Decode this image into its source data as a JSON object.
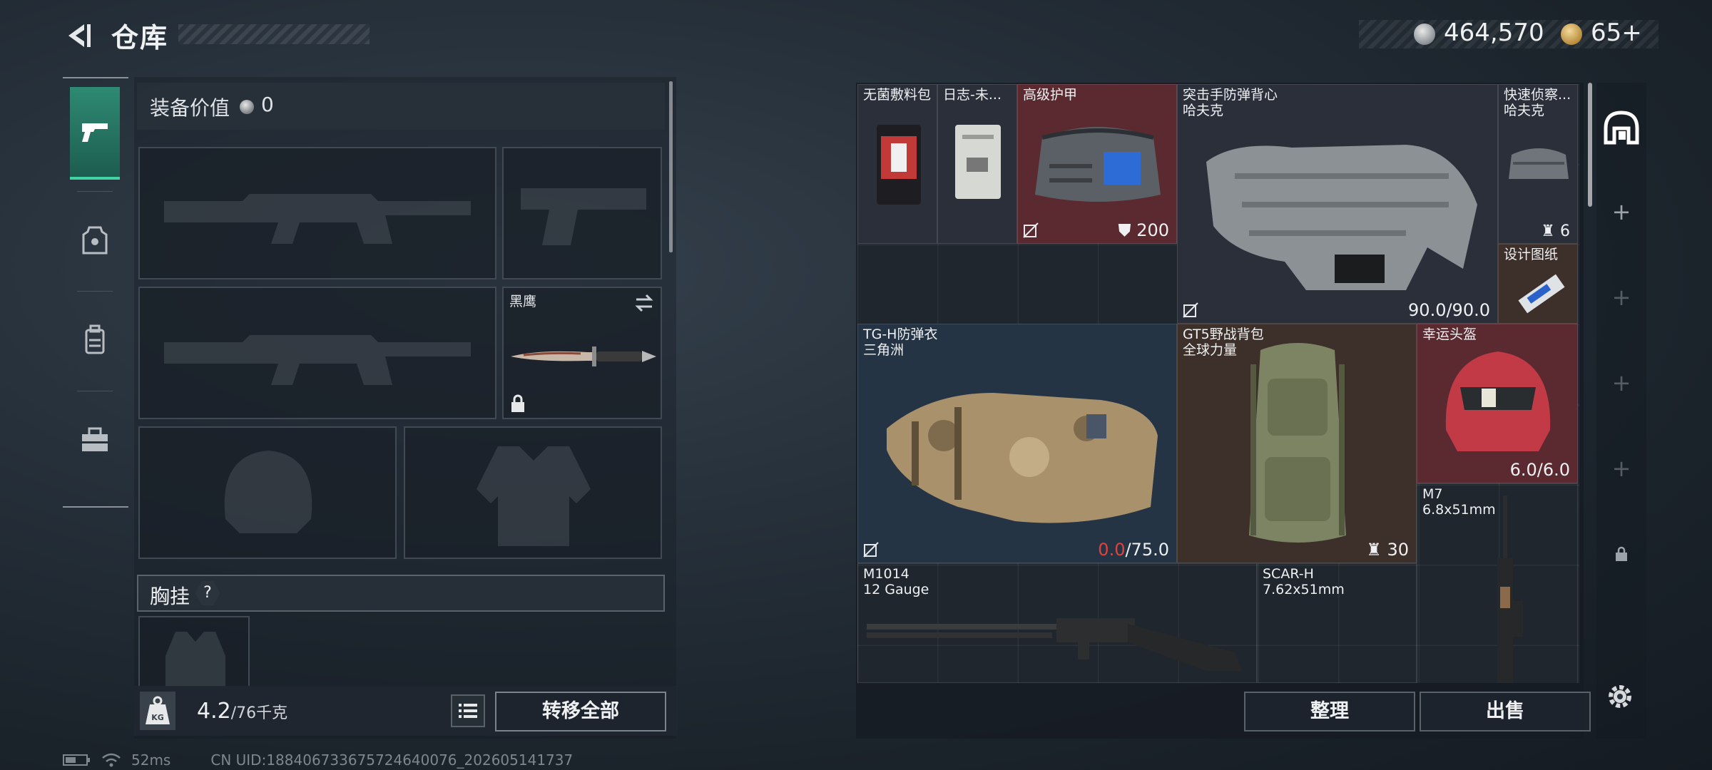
{
  "header": {
    "title": "仓库",
    "money": "464,570",
    "gold": "65+"
  },
  "tabs": [
    {
      "name": "pistol-icon",
      "active": true
    },
    {
      "name": "equipment-icon",
      "active": false
    },
    {
      "name": "backpack-icon",
      "active": false
    },
    {
      "name": "toolbox-icon",
      "active": false
    }
  ],
  "equipment": {
    "value_label": "装备价值",
    "value": "0",
    "knife_label": "黑鹰",
    "chest_rig_label": "胸挂",
    "help": "?"
  },
  "weight": {
    "current": "4.2",
    "max": "/76千克"
  },
  "buttons": {
    "transfer_all": "转移全部",
    "sort": "整理",
    "sell": "出售"
  },
  "status": {
    "ping": "52ms",
    "uid": "CN UID:18840673367572464007​6_202605141737"
  },
  "warehouse": {
    "items": [
      {
        "name": "无菌敷料包"
      },
      {
        "name": "日志-未..."
      },
      {
        "name": "高级护甲",
        "stat": "200"
      },
      {
        "name": "突击手防弹背心",
        "sub": "哈夫克",
        "stat": "90.0/90.0"
      },
      {
        "name": "快速侦察...",
        "sub": "哈夫克",
        "stat": "6"
      },
      {
        "name": "设计图纸"
      },
      {
        "name": "TG-H防弹衣",
        "sub": "三角洲",
        "stat_red": "0.0",
        "stat": "/75.0"
      },
      {
        "name": "GT5野战背包",
        "sub": "全球力量",
        "stat": "30"
      },
      {
        "name": "幸运头盔",
        "stat": "6.0/6.0"
      },
      {
        "name": "M7",
        "sub": "6.8x51mm"
      },
      {
        "name": "M1014",
        "sub": "12 Gauge"
      },
      {
        "name": "SCAR-H",
        "sub": "7.62x51mm"
      }
    ]
  },
  "colors": {
    "accent_teal": "#41d3a2",
    "durability_low": "#e0433c"
  }
}
